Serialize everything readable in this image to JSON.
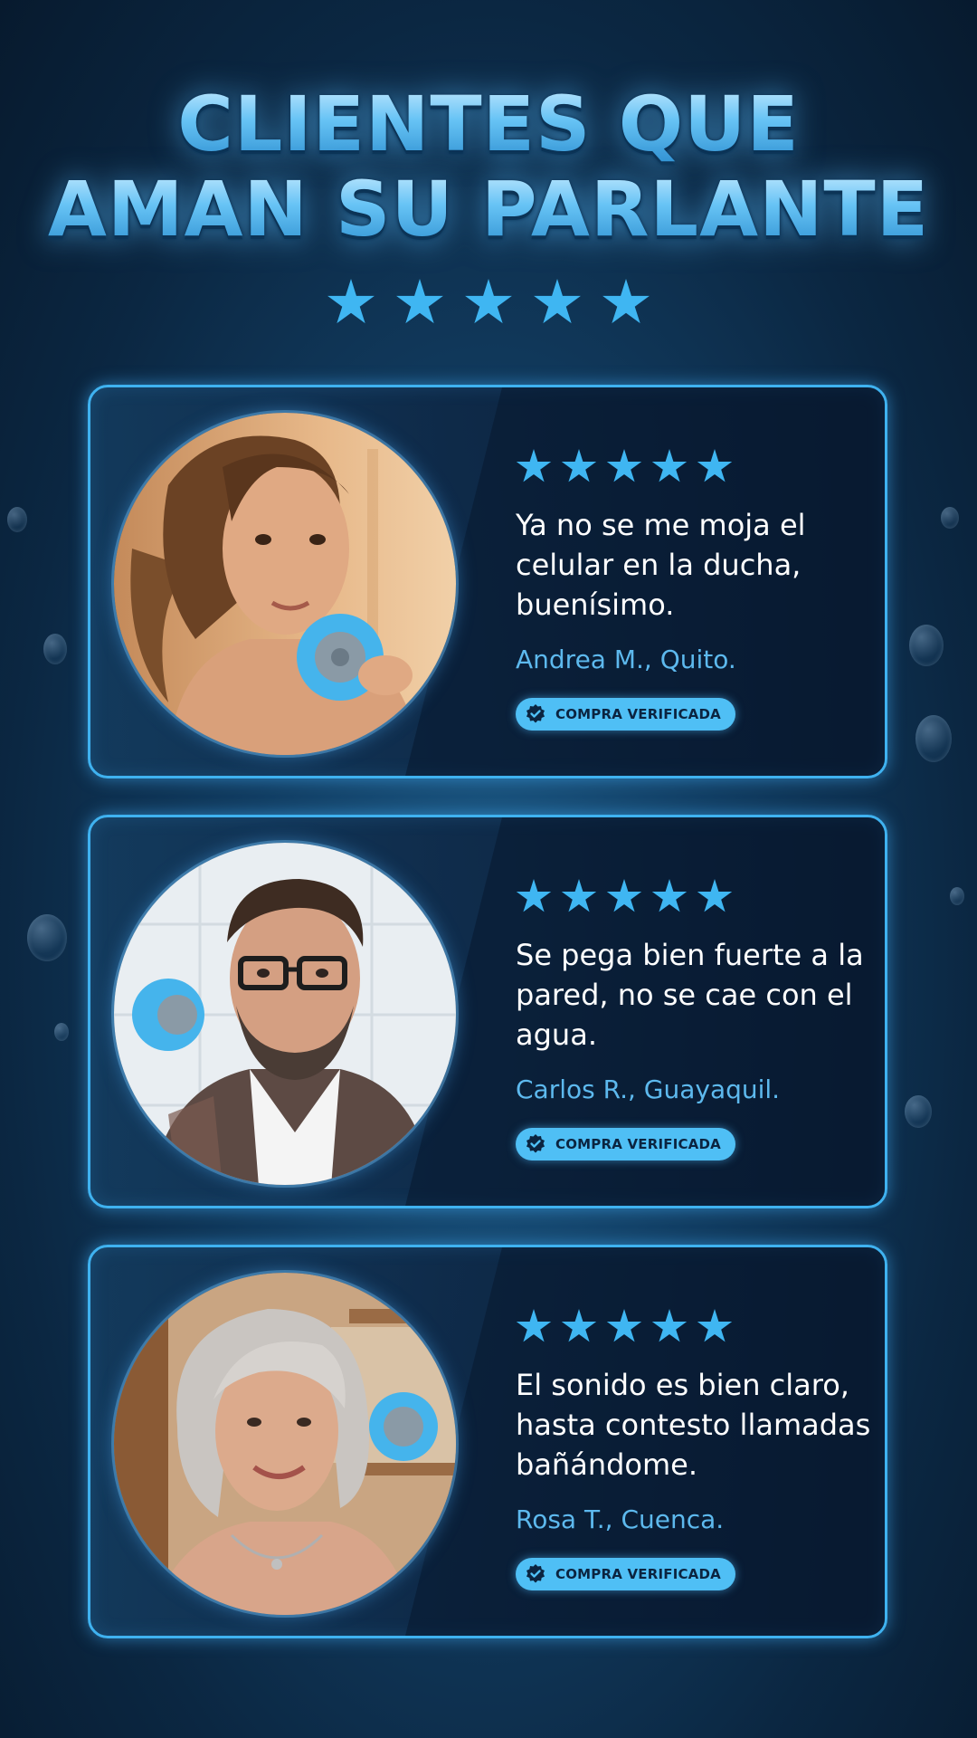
{
  "header": {
    "title_line1": "CLIENTES QUE",
    "title_line2": "AMAN SU PARLANTE",
    "stars": 5
  },
  "reviews": [
    {
      "stars": 5,
      "quote": "Ya no se me moja el celular en la ducha, buenísimo.",
      "author": "Andrea M., Quito.",
      "badge": "COMPRA VERIFICADA",
      "photo_icon": "woman-with-speaker-photo"
    },
    {
      "stars": 5,
      "quote": "Se pega bien fuerte a la pared, no se cae con el agua.",
      "author": "Carlos R., Guayaquil.",
      "badge": "COMPRA VERIFICADA",
      "photo_icon": "man-with-speaker-photo"
    },
    {
      "stars": 5,
      "quote": "El sonido es bien claro, hasta contesto llamadas bañándome.",
      "author": "Rosa T., Cuenca.",
      "badge": "COMPRA VERIFICADA",
      "photo_icon": "older-woman-with-speaker-photo"
    }
  ],
  "colors": {
    "accent": "#3fb6f2",
    "badge_bg": "#4fbff5",
    "author": "#5db9ee",
    "background": "#0b2742"
  }
}
